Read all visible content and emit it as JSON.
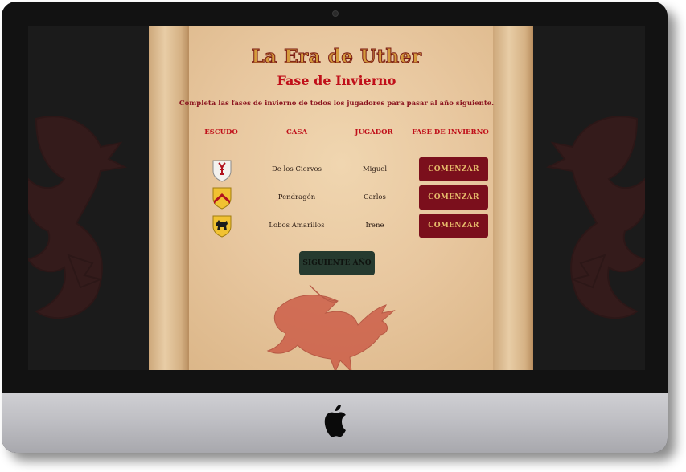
{
  "game": {
    "title": "La Era de Uther",
    "subtitle": "Fase de Invierno",
    "instructions": "Completa las fases de invierno de todos los jugadores para pasar al año siguiente."
  },
  "table": {
    "headers": [
      "ESCUDO",
      "CASA",
      "JUGADOR",
      "FASE DE INVIERNO"
    ],
    "rows": [
      {
        "house": "De los Ciervos",
        "player": "Miguel",
        "action": "COMENZAR",
        "shield": "stag-shield-icon"
      },
      {
        "house": "Pendragón",
        "player": "Carlos",
        "action": "COMENZAR",
        "shield": "chevron-shield-icon"
      },
      {
        "house": "Lobos Amarillos",
        "player": "Irene",
        "action": "COMENZAR",
        "shield": "wolf-shield-icon"
      }
    ]
  },
  "next_button": "SIGUIENTE AÑO",
  "colors": {
    "title_gold": "#d49a3c",
    "accent_red": "#c0101a",
    "button_red": "#7b0f1c",
    "button_text": "#e4b96a",
    "next_button_bg": "#263a2f",
    "parchment": "#e8c79f"
  }
}
